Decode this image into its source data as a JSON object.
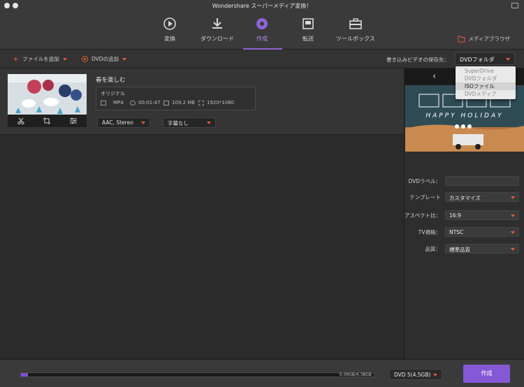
{
  "window": {
    "title": "Wondershare スーパーメディア変換！"
  },
  "nav": {
    "items": [
      {
        "label": "変換",
        "icon": "play-circle-icon"
      },
      {
        "label": "ダウンロード",
        "icon": "download-icon"
      },
      {
        "label": "作成",
        "icon": "disc-icon",
        "active": true
      },
      {
        "label": "転送",
        "icon": "transfer-icon"
      },
      {
        "label": "ツールボックス",
        "icon": "toolbox-icon"
      }
    ],
    "media_browser": "メディアブラウザ"
  },
  "toolbar": {
    "add_file": "ファイルを追加",
    "add_dvd": "DVDの追加",
    "save_label": "書き込みビデオの保存先：",
    "save_value": "DVDフォルダ",
    "dropdown_options": [
      "SuperDrive",
      "DVDフォルダ",
      "ISOファイル",
      "DVDメディア"
    ],
    "dropdown_highlighted": "ISOファイル"
  },
  "file": {
    "title": "春を楽しむ",
    "original_label": "オリジナル",
    "format": "MP4",
    "duration": "00:01:47",
    "size": "109.2 MB",
    "resolution": "1920*1080",
    "audio": "AAC, Stereo",
    "subtitle": "字幕なし"
  },
  "preview": {
    "text": "HAPPY HOLIDAY"
  },
  "settings": {
    "dvd_label": {
      "label": "DVDラベル：",
      "value": ""
    },
    "template": {
      "label": "テンプレート",
      "value": "カスタマイズ"
    },
    "aspect": {
      "label": "アスペクト比：",
      "value": "16:9"
    },
    "tv": {
      "label": "TV規格：",
      "value": "NTSC"
    },
    "quality": {
      "label": "品質：",
      "value": "標準品質"
    }
  },
  "bottom": {
    "progress_text": "0.09GB/4.38GB",
    "progress_fraction": 0.0205,
    "disc": "DVD 5(4.5GB)",
    "create": "作成"
  },
  "colors": {
    "accent": "#8658d6",
    "orange": "#e05a3a"
  }
}
